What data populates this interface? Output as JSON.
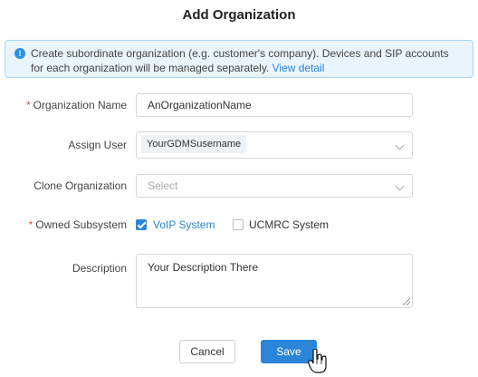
{
  "dialog": {
    "title": "Add Organization",
    "info": {
      "text": "Create subordinate organization (e.g. customer's company). Devices and SIP accounts for each organization will be managed separately.",
      "link": "View detail"
    }
  },
  "form": {
    "org_name": {
      "label": "Organization Name",
      "required": "*",
      "value": "AnOrganizationName"
    },
    "assign_user": {
      "label": "Assign User",
      "tag": "YourGDMSusername"
    },
    "clone_org": {
      "label": "Clone Organization",
      "placeholder": "Select"
    },
    "subsystem": {
      "label": "Owned Subsystem",
      "required": "*",
      "options": [
        {
          "label": "VoIP System",
          "checked": true
        },
        {
          "label": "UCMRC System",
          "checked": false
        }
      ]
    },
    "description": {
      "label": "Description",
      "value": "Your Description There"
    }
  },
  "buttons": {
    "cancel": "Cancel",
    "save": "Save"
  },
  "colors": {
    "accent": "#2a85d8",
    "required": "#e8473a",
    "banner_bg": "#e9f4fd"
  }
}
